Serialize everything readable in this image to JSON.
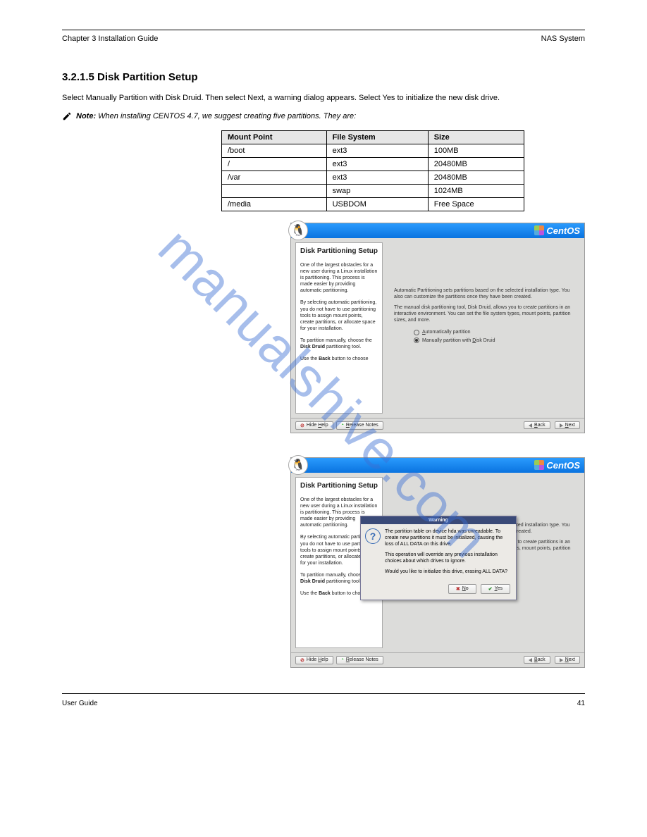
{
  "watermark": "manualshive.com",
  "header": {
    "left": "Chapter 3 Installation Guide",
    "right": "NAS System"
  },
  "section_title": "3.2.1.5 Disk Partition Setup",
  "paragraph1": "Select Manually Partition with Disk Druid. Then select Next, a warning dialog appears. Select Yes to initialize the new disk drive.",
  "note_label": "Note:",
  "note_text": " When installing CENTOS 4.7, we suggest creating five partitions. They are:",
  "table": {
    "headers": [
      "Mount Point",
      "File System",
      "Size"
    ],
    "rows": [
      [
        "/boot",
        "ext3",
        "100MB"
      ],
      [
        "/",
        "ext3",
        "20480MB"
      ],
      [
        "/var",
        "ext3",
        "20480MB"
      ],
      [
        "",
        "swap",
        "1024MB"
      ],
      [
        "/media",
        "USBDOM",
        "Free Space"
      ]
    ]
  },
  "installer": {
    "brand": "CentOS",
    "help": {
      "title": "Disk Partitioning Setup",
      "p1": "One of the largest obstacles for a new user during a Linux installation is partitioning. This process is made easier by providing automatic partitioning.",
      "p2": "By selecting automatic partitioning, you do not have to use partitioning tools to assign mount points, create partitions, or allocate space for your installation.",
      "p3a": "To partition manually, choose the ",
      "p3b": "Disk Druid",
      "p3c": " partitioning tool.",
      "p4a": "Use the ",
      "p4b": "Back",
      "p4c": " button to choose"
    },
    "main": {
      "p1": "Automatic Partitioning sets partitions based on the selected installation type. You also can customize the partitions once they have been created.",
      "p2": "The manual disk partitioning tool, Disk Druid, allows you to create partitions in an interactive environment. You can set the file system types, mount points, partition sizes, and more.",
      "radio_auto": "Automatically partition",
      "radio_manual": "Manually partition with Disk Druid"
    },
    "footer": {
      "hide_help": "Hide Help",
      "release_notes": "Release Notes",
      "back": "Back",
      "next": "Next"
    }
  },
  "dialog": {
    "title": "Warning",
    "p1": "The partition table on device hda was unreadable. To create new partitions it must be initialized, causing the loss of ALL DATA on this drive.",
    "p2": "This operation will override any previous installation choices about which drives to ignore.",
    "p3": "Would you like to initialize this drive, erasing ALL DATA?",
    "no": "No",
    "yes": "Yes"
  },
  "footer": {
    "left": "User Guide",
    "right": "41"
  }
}
